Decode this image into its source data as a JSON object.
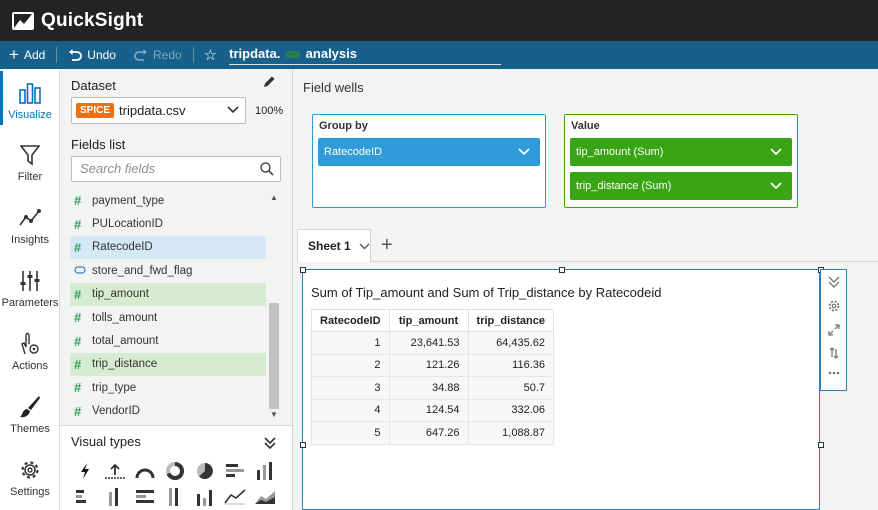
{
  "app": {
    "name": "QuickSight"
  },
  "toolbar": {
    "add_label": "Add",
    "undo_label": "Undo",
    "redo_label": "Redo",
    "analysis_name_part1": "tripdata.",
    "analysis_name_part2": "analysis"
  },
  "rail": {
    "items": [
      {
        "label": "Visualize",
        "icon": "bar-chart-icon",
        "active": true
      },
      {
        "label": "Filter",
        "icon": "funnel-icon"
      },
      {
        "label": "Insights",
        "icon": "insights-icon"
      },
      {
        "label": "Parameters",
        "icon": "sliders-icon"
      },
      {
        "label": "Actions",
        "icon": "pointer-gear-icon"
      },
      {
        "label": "Themes",
        "icon": "brush-icon"
      },
      {
        "label": "Settings",
        "icon": "gear-icon"
      }
    ]
  },
  "dataset": {
    "heading": "Dataset",
    "badge": "SPICE",
    "name": "tripdata.csv",
    "percent": "100%"
  },
  "fields_list": {
    "heading": "Fields list",
    "search_placeholder": "Search fields",
    "items": [
      {
        "name": "payment_type",
        "kind": "measure",
        "state": "none"
      },
      {
        "name": "PULocationID",
        "kind": "measure",
        "state": "none"
      },
      {
        "name": "RatecodeID",
        "kind": "measure",
        "state": "group"
      },
      {
        "name": "store_and_fwd_flag",
        "kind": "dimension",
        "state": "none"
      },
      {
        "name": "tip_amount",
        "kind": "measure",
        "state": "value"
      },
      {
        "name": "tolls_amount",
        "kind": "measure",
        "state": "none"
      },
      {
        "name": "total_amount",
        "kind": "measure",
        "state": "none"
      },
      {
        "name": "trip_distance",
        "kind": "measure",
        "state": "value"
      },
      {
        "name": "trip_type",
        "kind": "measure",
        "state": "none"
      },
      {
        "name": "VendorID",
        "kind": "measure",
        "state": "none"
      }
    ]
  },
  "visual_types": {
    "heading": "Visual types"
  },
  "field_wells": {
    "heading": "Field wells",
    "group_by": {
      "label": "Group by",
      "fields": [
        "RatecodeID"
      ]
    },
    "value": {
      "label": "Value",
      "fields": [
        "tip_amount (Sum)",
        "trip_distance (Sum)"
      ]
    }
  },
  "sheets": {
    "tabs": [
      "Sheet 1"
    ]
  },
  "visual": {
    "title": "Sum of Tip_amount and Sum of Trip_distance by Ratecodeid",
    "columns": [
      "RatecodeID",
      "tip_amount",
      "trip_distance"
    ],
    "rows": [
      [
        "1",
        "23,641.53",
        "64,435.62"
      ],
      [
        "2",
        "121.26",
        "116.36"
      ],
      [
        "3",
        "34.88",
        "50.7"
      ],
      [
        "4",
        "124.54",
        "332.06"
      ],
      [
        "5",
        "647.26",
        "1,088.87"
      ]
    ]
  },
  "colors": {
    "header_bg": "#232323",
    "toolbar_bg": "#17608c",
    "accent_blue": "#2f9bd8",
    "accent_green": "#3aa514",
    "spice_orange": "#ec7211"
  }
}
